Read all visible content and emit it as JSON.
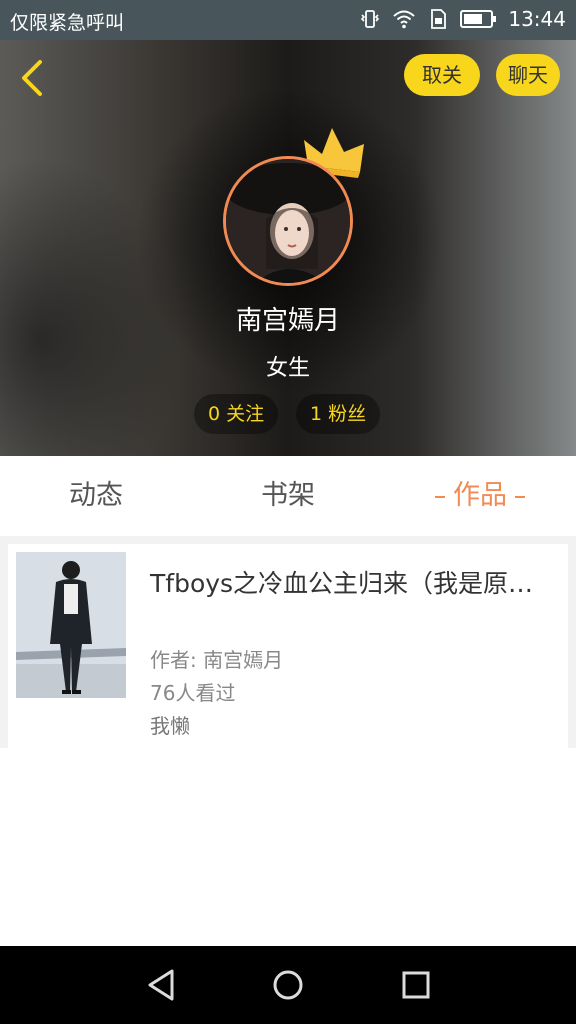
{
  "status_bar": {
    "carrier": "仅限紧急呼叫",
    "time": "13:44",
    "icons": [
      "vibrate-icon",
      "wifi-icon",
      "sim-icon",
      "battery-icon"
    ]
  },
  "header": {
    "unfollow_label": "取关",
    "chat_label": "聊天",
    "username": "南宫嫣月",
    "gender": "女生",
    "following_count": "0",
    "following_label": "关注",
    "fans_count": "1",
    "fans_label": "粉丝"
  },
  "tabs": [
    {
      "label": "动态",
      "active": false
    },
    {
      "label": "书架",
      "active": false
    },
    {
      "label": "作品",
      "active": true
    }
  ],
  "works": [
    {
      "title": "Tfboys之冷血公主归来（我是原…",
      "author": "作者: 南宫嫣月",
      "views": "76人看过",
      "description": "我懒"
    }
  ],
  "colors": {
    "accent_yellow": "#f7d61c",
    "accent_orange": "#f28a54",
    "status_bar": "#48565c"
  }
}
